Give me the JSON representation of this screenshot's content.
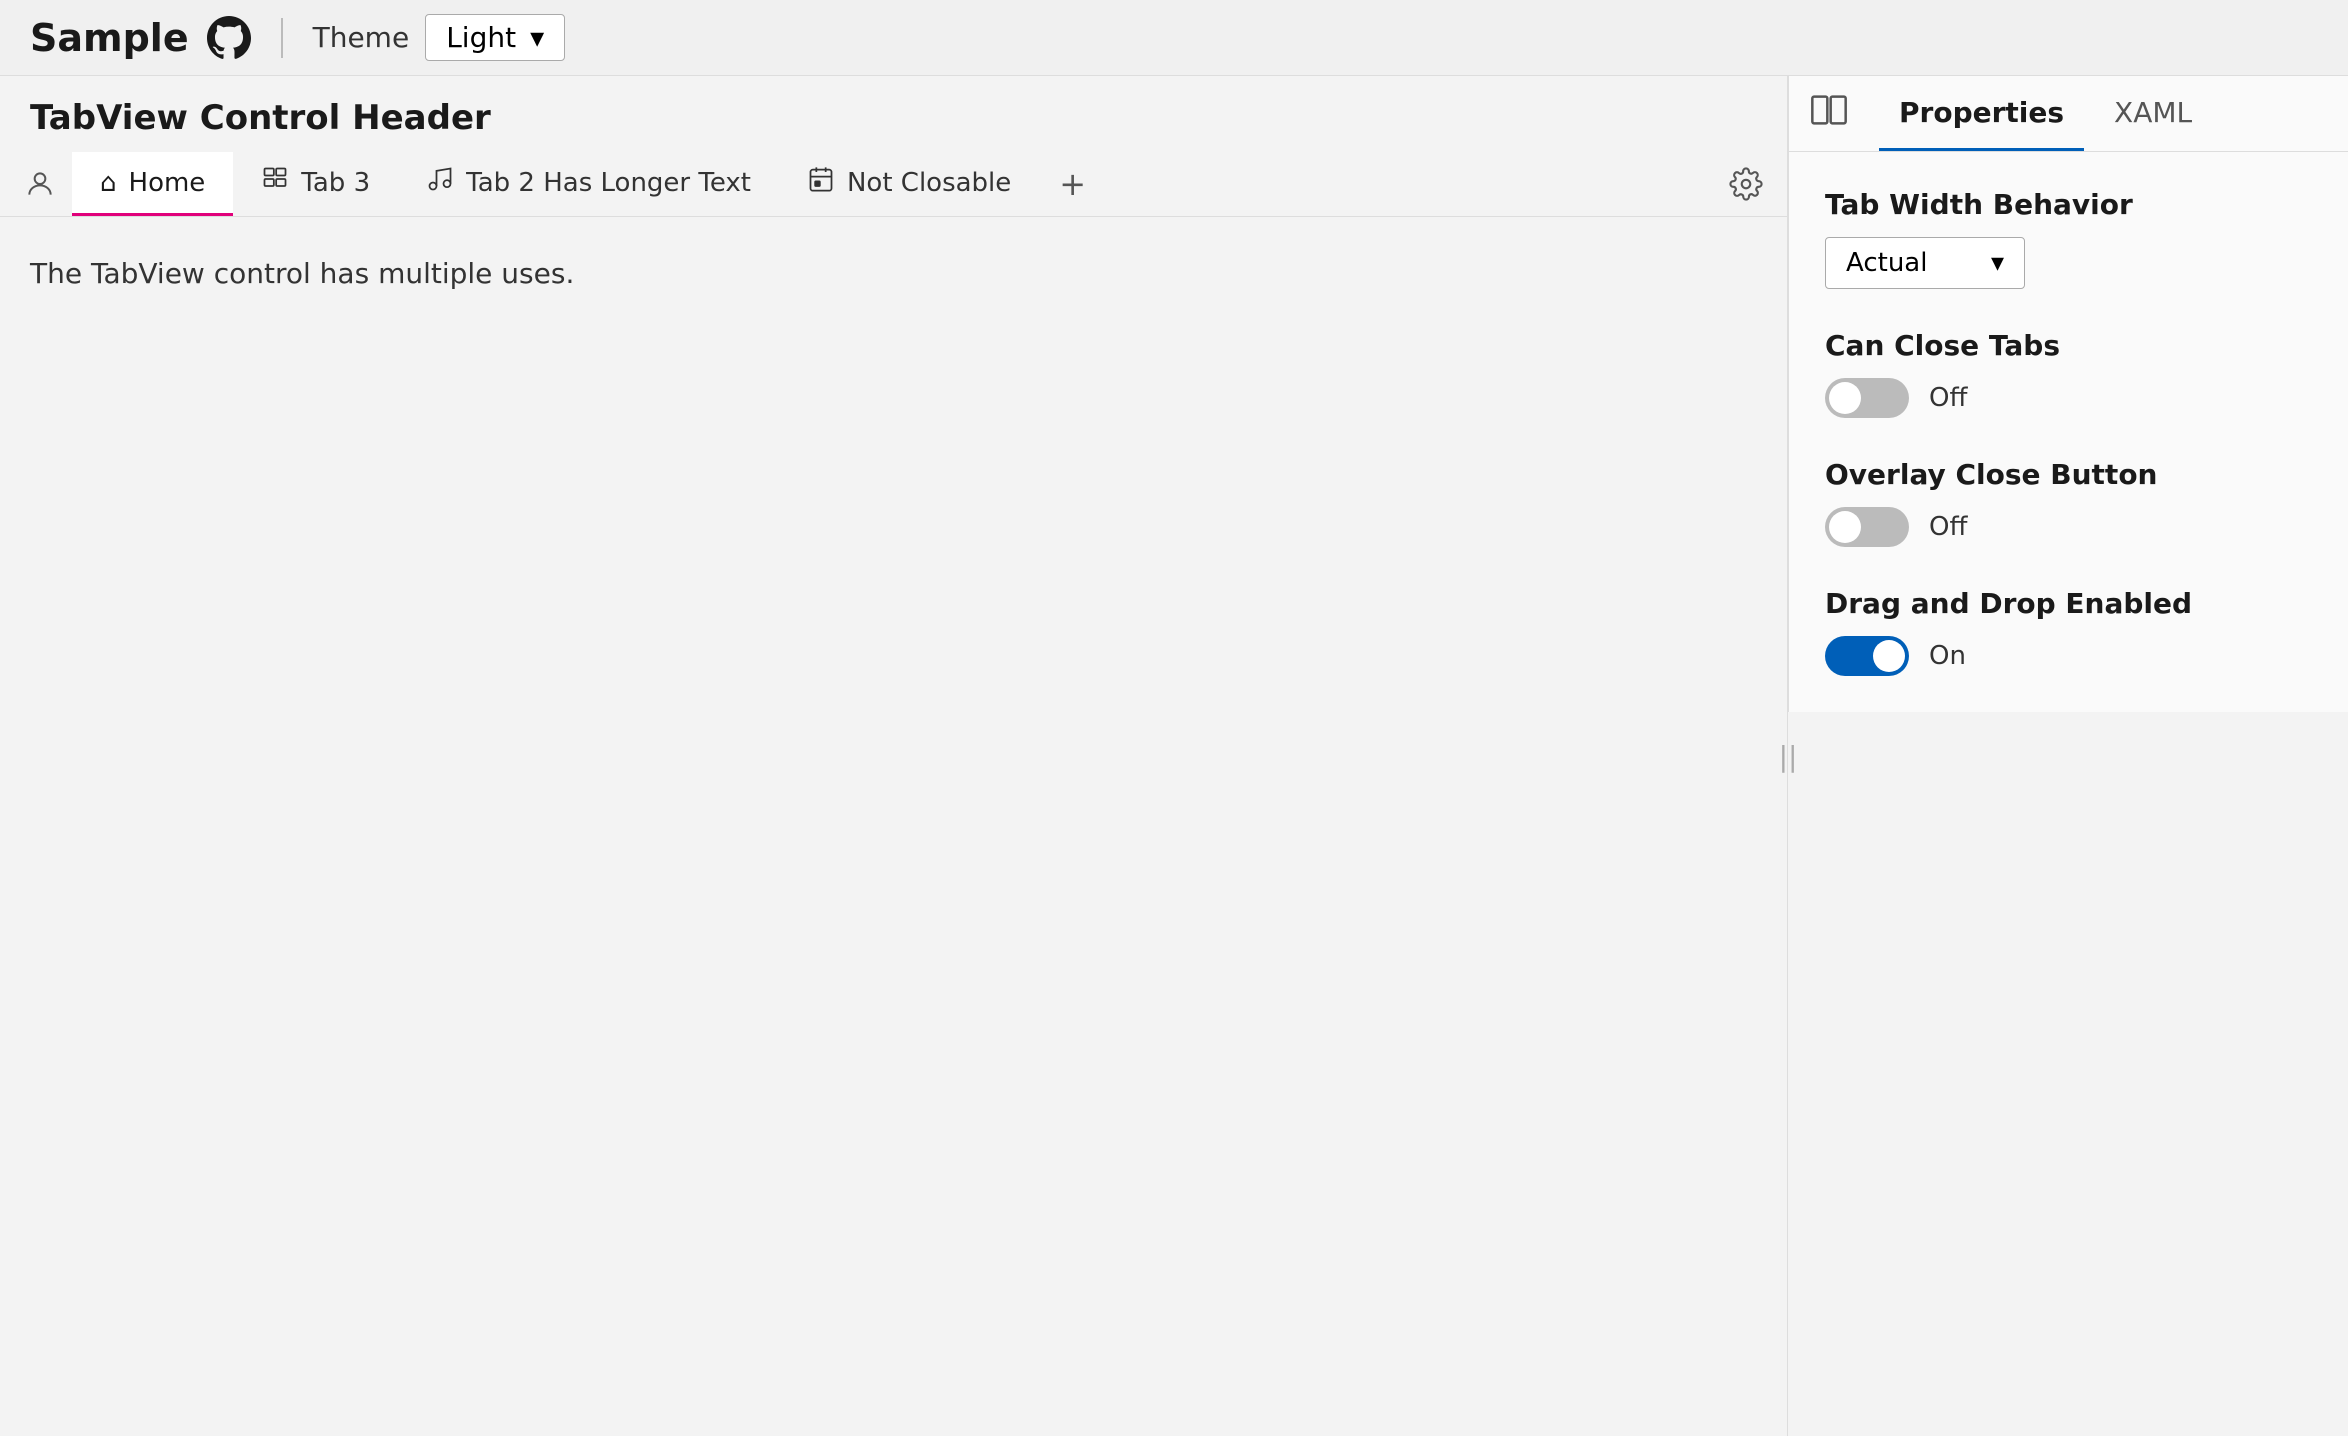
{
  "topbar": {
    "app_title": "Sample",
    "theme_label": "Theme",
    "theme_value": "Light",
    "github_icon": "github-icon",
    "chevron_icon": "▾"
  },
  "left": {
    "section_title": "TabView Control Header",
    "tabs": [
      {
        "id": "home",
        "label": "Home",
        "icon": "⌂",
        "active": true
      },
      {
        "id": "tab3",
        "label": "Tab 3",
        "icon": "⊡"
      },
      {
        "id": "tab2longer",
        "label": "Tab 2 Has Longer Text",
        "icon": "♪"
      },
      {
        "id": "notclosable",
        "label": "Not Closable",
        "icon": "▦"
      }
    ],
    "content_text": "The TabView control has multiple uses."
  },
  "right_panel": {
    "panel_tab_properties": "Properties",
    "panel_tab_xaml": "XAML",
    "tab_width_behavior_label": "Tab Width Behavior",
    "tab_width_value": "Actual",
    "can_close_tabs_label": "Can Close Tabs",
    "can_close_tabs_state": "Off",
    "can_close_tabs_on": false,
    "overlay_close_button_label": "Overlay Close Button",
    "overlay_close_button_state": "Off",
    "overlay_close_button_on": false,
    "drag_drop_label": "Drag and Drop Enabled",
    "drag_drop_state": "On",
    "drag_drop_on": true
  }
}
